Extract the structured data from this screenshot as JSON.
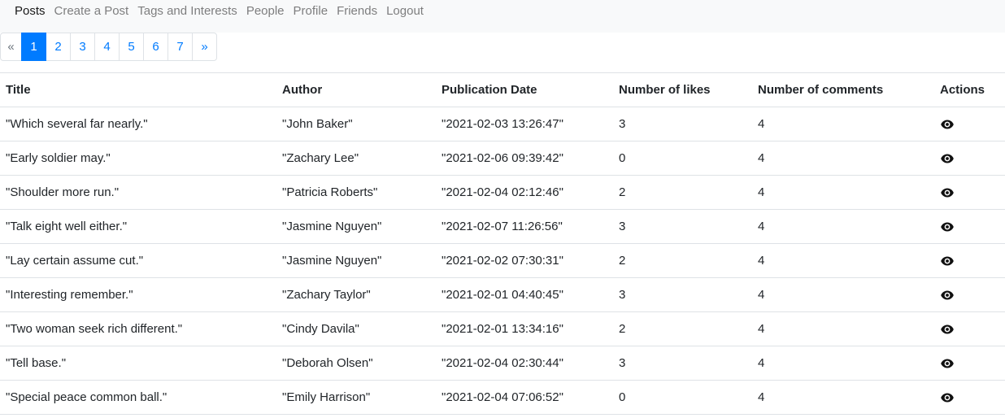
{
  "nav": {
    "items": [
      {
        "label": "Posts"
      },
      {
        "label": "Create a Post"
      },
      {
        "label": "Tags and Interests"
      },
      {
        "label": "People"
      },
      {
        "label": "Profile"
      },
      {
        "label": "Friends"
      },
      {
        "label": "Logout"
      }
    ],
    "active": "Posts"
  },
  "pagination": {
    "prev": "«",
    "next": "»",
    "pages": [
      "1",
      "2",
      "3",
      "4",
      "5",
      "6",
      "7"
    ],
    "current": "1",
    "colors": {
      "active_bg": "#007bff",
      "link": "#007bff"
    }
  },
  "table": {
    "headers": {
      "title": "Title",
      "author": "Author",
      "date": "Publication Date",
      "likes": "Number of likes",
      "comments": "Number of comments",
      "actions": "Actions"
    },
    "rows": [
      {
        "title": "\"Which several far nearly.\"",
        "author": "\"John Baker\"",
        "date": "\"2021-02-03 13:26:47\"",
        "likes": "3",
        "comments": "4",
        "action_icon": "eye-icon"
      },
      {
        "title": "\"Early soldier may.\"",
        "author": "\"Zachary Lee\"",
        "date": "\"2021-02-06 09:39:42\"",
        "likes": "0",
        "comments": "4",
        "action_icon": "eye-icon"
      },
      {
        "title": "\"Shoulder more run.\"",
        "author": "\"Patricia Roberts\"",
        "date": "\"2021-02-04 02:12:46\"",
        "likes": "2",
        "comments": "4",
        "action_icon": "eye-icon"
      },
      {
        "title": "\"Talk eight well either.\"",
        "author": "\"Jasmine Nguyen\"",
        "date": "\"2021-02-07 11:26:56\"",
        "likes": "3",
        "comments": "4",
        "action_icon": "eye-icon"
      },
      {
        "title": "\"Lay certain assume cut.\"",
        "author": "\"Jasmine Nguyen\"",
        "date": "\"2021-02-02 07:30:31\"",
        "likes": "2",
        "comments": "4",
        "action_icon": "eye-icon"
      },
      {
        "title": "\"Interesting remember.\"",
        "author": "\"Zachary Taylor\"",
        "date": "\"2021-02-01 04:40:45\"",
        "likes": "3",
        "comments": "4",
        "action_icon": "eye-icon"
      },
      {
        "title": "\"Two woman seek rich different.\"",
        "author": "\"Cindy Davila\"",
        "date": "\"2021-02-01 13:34:16\"",
        "likes": "2",
        "comments": "4",
        "action_icon": "eye-icon"
      },
      {
        "title": "\"Tell base.\"",
        "author": "\"Deborah Olsen\"",
        "date": "\"2021-02-04 02:30:44\"",
        "likes": "3",
        "comments": "4",
        "action_icon": "eye-icon"
      },
      {
        "title": "\"Special peace common ball.\"",
        "author": "\"Emily Harrison\"",
        "date": "\"2021-02-04 07:06:52\"",
        "likes": "0",
        "comments": "4",
        "action_icon": "eye-icon"
      }
    ]
  }
}
